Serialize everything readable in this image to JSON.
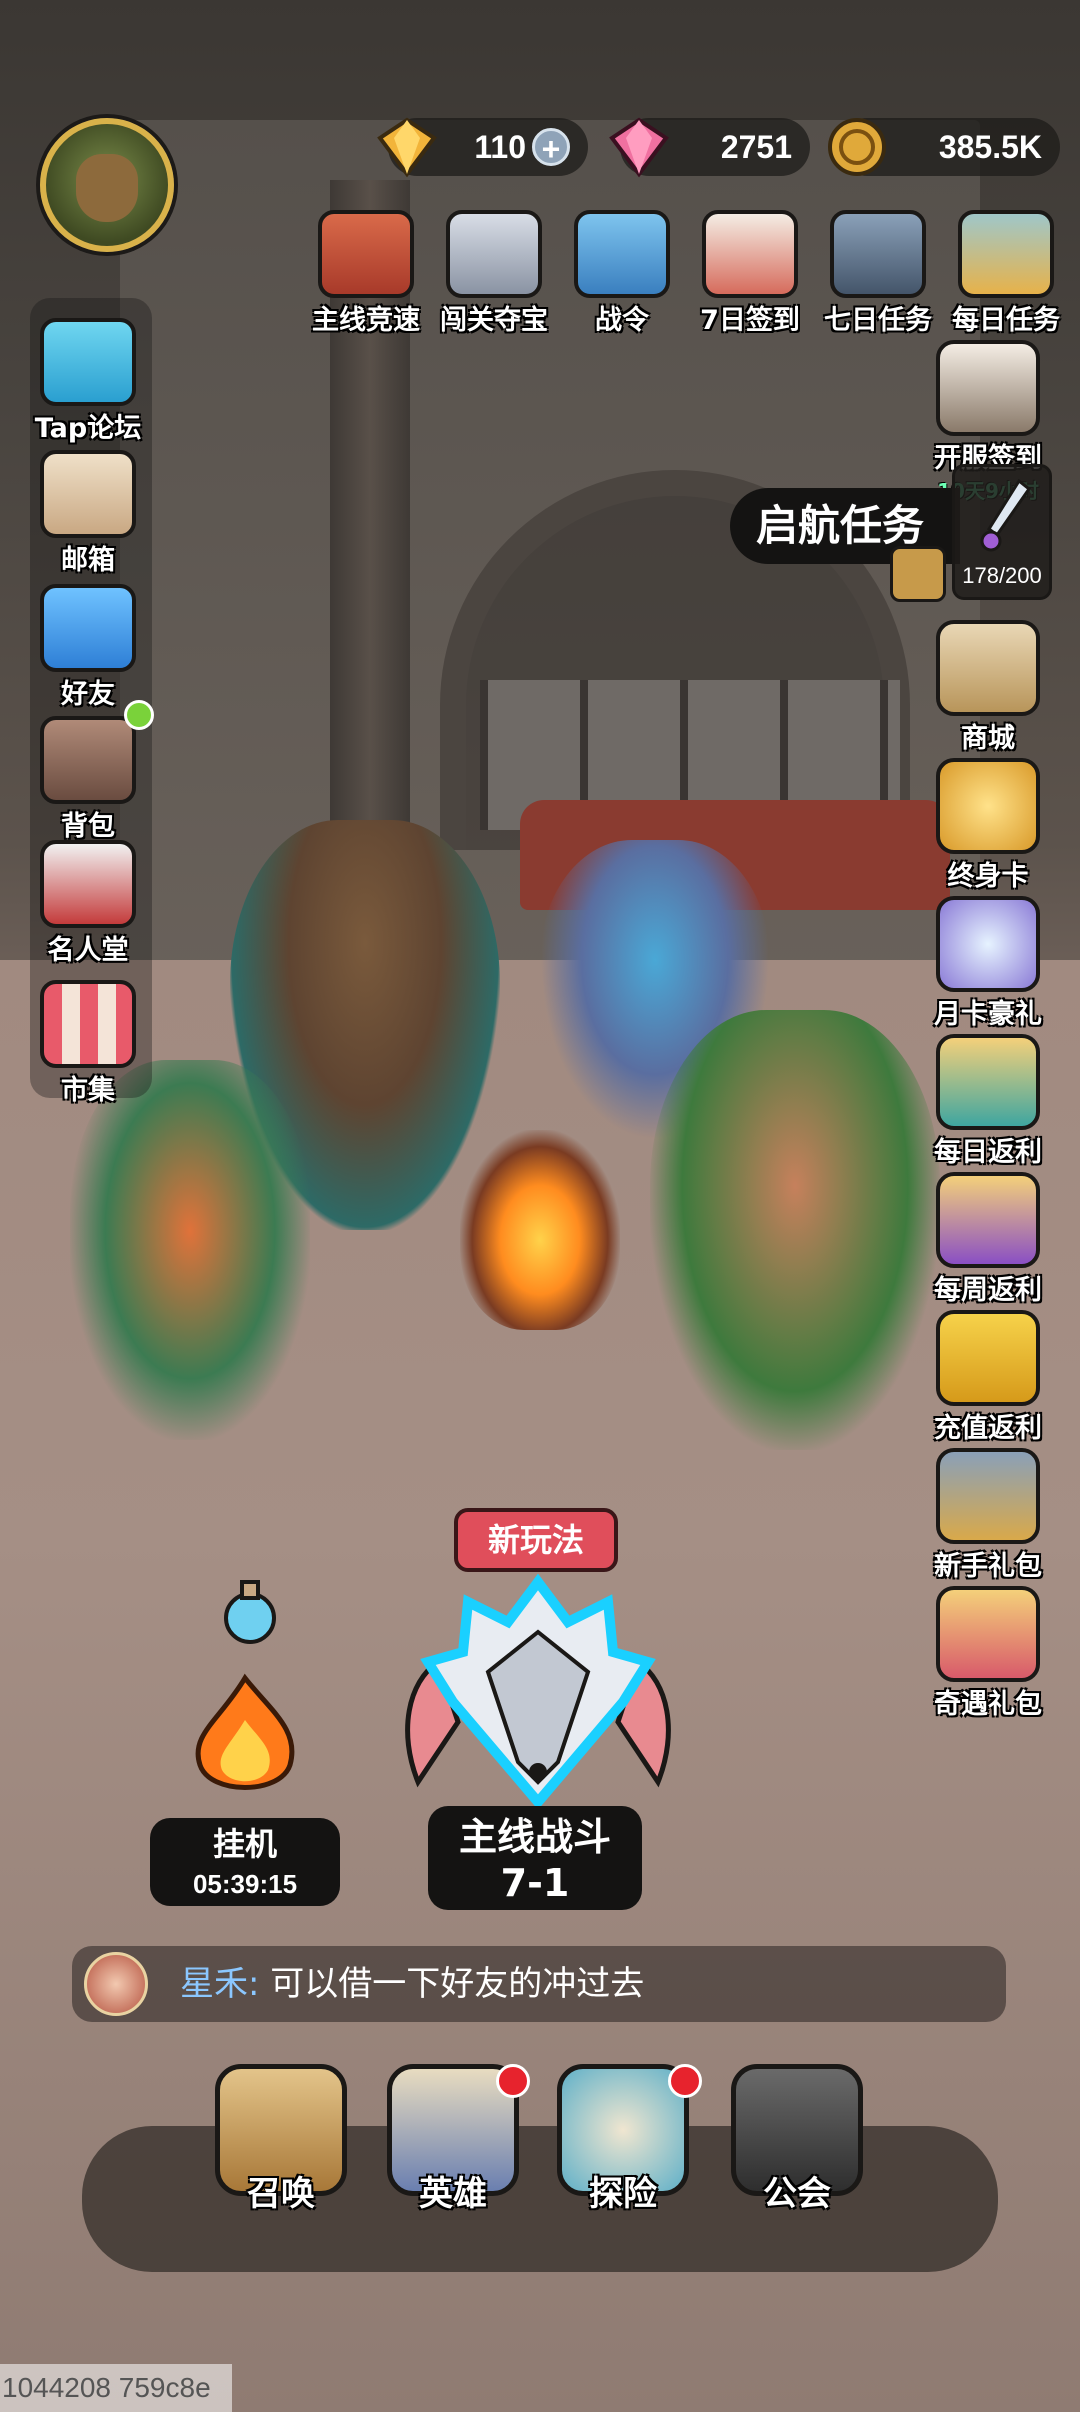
{
  "currencies": {
    "gems_blue": "110",
    "gems_pink": "2751",
    "coins": "385.5K"
  },
  "top_icons": [
    "主线竞速",
    "闯关夺宝",
    "战令",
    "7日签到",
    "七日任务",
    "每日任务"
  ],
  "left_icons": [
    "Tap论坛",
    "邮箱",
    "好友",
    "背包",
    "名人堂",
    "市集"
  ],
  "right_icons": {
    "server_signin": "开服签到",
    "server_signin_timer": "10天9小时",
    "items": [
      "商城",
      "终身卡",
      "月卡豪礼",
      "每日返利",
      "每周返利",
      "充值返利",
      "新手礼包",
      "奇遇礼包"
    ]
  },
  "quest": {
    "title": "启航任务",
    "progress": "178/200"
  },
  "battle": {
    "badge": "新玩法",
    "label": "主线战斗",
    "stage": "7-1"
  },
  "idle": {
    "label": "挂机",
    "timer": "05:39:15"
  },
  "chat": {
    "sender": "星禾:",
    "message": "可以借一下好友的冲过去"
  },
  "nav": [
    "召唤",
    "英雄",
    "探险",
    "公会"
  ],
  "watermark": "1044208 759c8e",
  "colors": {
    "accent_red": "#e04e5b",
    "badge_green": "#6dffb5",
    "chat_name": "#8bc7ff"
  }
}
